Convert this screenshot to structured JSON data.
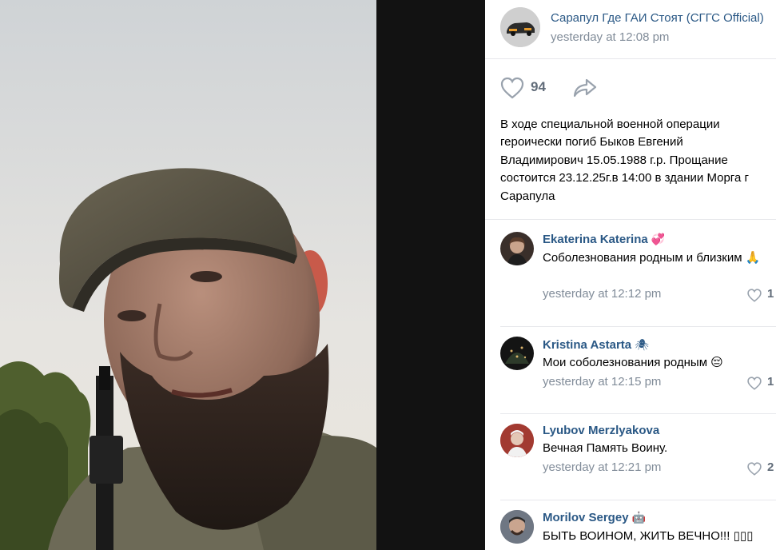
{
  "post": {
    "group_name": "Сарапул Где ГАИ Стоят (СГГС Official)",
    "time": "yesterday at 12:08 pm",
    "likes": "94",
    "text": "В ходе специальной военной операции\nгероически погиб Быков Евгений\nВладимирович 15.05.1988 г.р. Прощание\nсостоится 23.12.25г.в 14:00 в здании Морга г\nСарапула"
  },
  "comments": [
    {
      "author": "Ekaterina Katerina",
      "emoji": "💞",
      "text": "Соболезнования родным и близким 🙏",
      "time": "yesterday at 12:12 pm",
      "likes": "1"
    },
    {
      "author": "Kristina Astarta",
      "emoji": "🕷",
      "text": "Мои соболезнования родным 😔",
      "time": "yesterday at 12:15 pm",
      "likes": "1"
    },
    {
      "author": "Lyubov Merzlyakova",
      "emoji": "",
      "text": "Вечная Память Воину.",
      "time": "yesterday at 12:21 pm",
      "likes": "2"
    },
    {
      "author": "Morilov Sergey",
      "emoji": "🤖",
      "text": "БЫТЬ ВОИНОМ, ЖИТЬ ВЕЧНО!!! ▯▯▯",
      "time": "",
      "likes": ""
    }
  ],
  "colors": {
    "link": "#2a5885",
    "muted": "#818c99",
    "divider": "#e7e8ec"
  }
}
